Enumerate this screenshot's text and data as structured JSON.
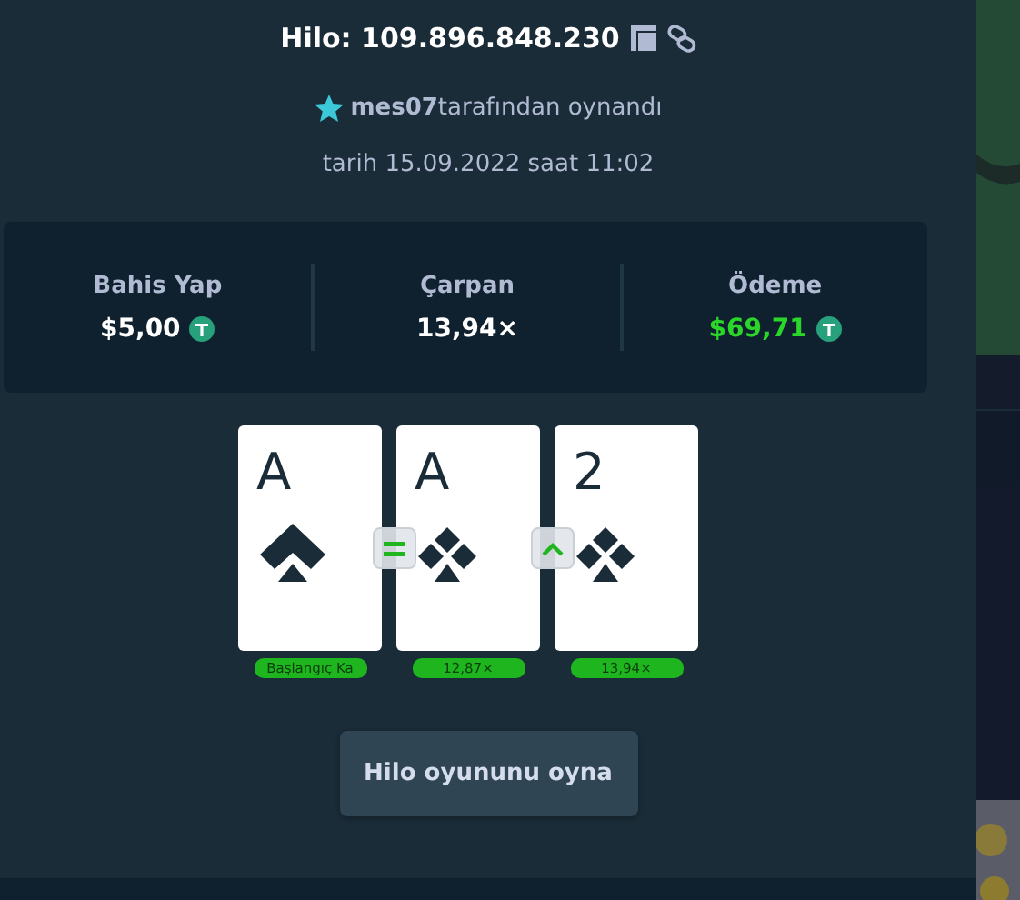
{
  "header": {
    "title": "Hilo: 109.896.848.230",
    "player_line": "**mes07**tarafından oynandı",
    "date": "tarih 15.09.2022 saat 11:02"
  },
  "stats": [
    {
      "label": "Bahis Yap",
      "value": "$5,00",
      "kind": "currency"
    },
    {
      "label": "Çarpan",
      "value": "13,94×",
      "kind": "plain"
    },
    {
      "label": "Ödeme",
      "value": "$69,71",
      "kind": "payout"
    }
  ],
  "cards": [
    {
      "rank": "A",
      "kind": "spades",
      "pill": "Başlangıç Ka"
    },
    {
      "rank": "A",
      "kind": "clubs",
      "pill": "12,87×"
    },
    {
      "rank": "2",
      "kind": "clubs",
      "pill": "13,94×"
    }
  ],
  "guesses": [
    {
      "kind": "same"
    },
    {
      "kind": "higher"
    }
  ],
  "play_button": "Hilo oyununu oyna"
}
